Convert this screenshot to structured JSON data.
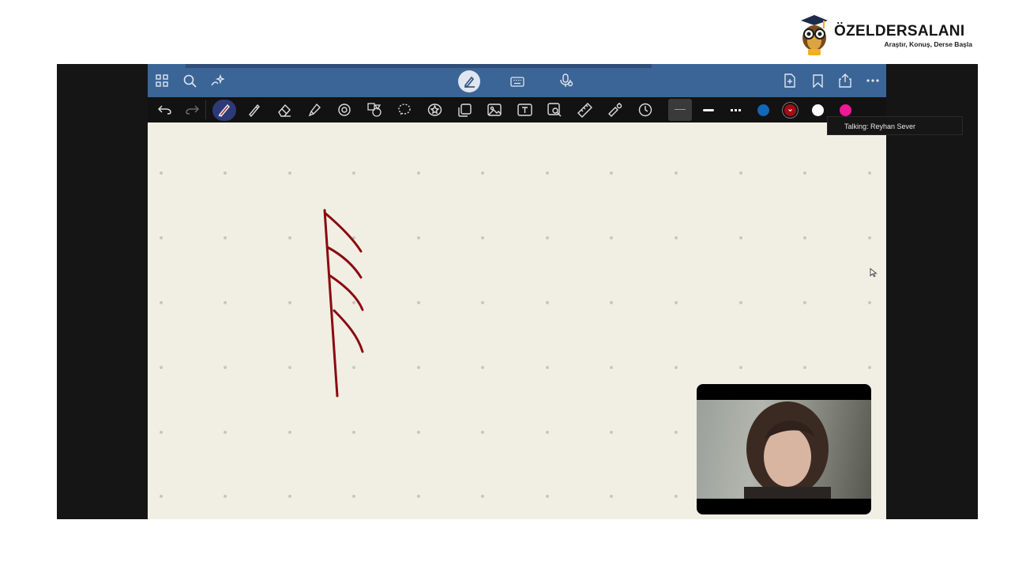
{
  "brand": {
    "name": "ÖZELDERSALANI",
    "slogan": "Araştır, Konuş, Derse Başla"
  },
  "tooltip": {
    "text": "Talking: Reyhan Sever"
  },
  "topbar_icons": {
    "left": [
      "grid-icon",
      "search-icon",
      "ai-sparkle-icon"
    ],
    "center": [
      "handwriting-mode-icon",
      "keyboard-icon",
      "voice-icon"
    ],
    "right": [
      "add-page-icon",
      "bookmark-icon",
      "share-icon",
      "more-icon"
    ]
  },
  "toolbar_icons": [
    "undo-icon",
    "redo-icon",
    "pen-icon",
    "pencil-icon",
    "eraser-icon",
    "highlighter-icon",
    "shapes-icon",
    "shape-tools-icon",
    "lasso-icon",
    "sticker-icon",
    "sticky-note-icon",
    "image-icon",
    "text-box-icon",
    "image-search-icon",
    "ruler-icon",
    "laser-pointer-icon",
    "timer-icon"
  ],
  "colors": {
    "topbar": "#3c6597",
    "toolbar": "#121212",
    "canvas": "#f1efe3",
    "ink": "#8b0a10",
    "swatch_blue": "#1167b8",
    "swatch_darkred": "#a40c14",
    "swatch_white": "#ffffff",
    "swatch_pink": "#f01898"
  }
}
